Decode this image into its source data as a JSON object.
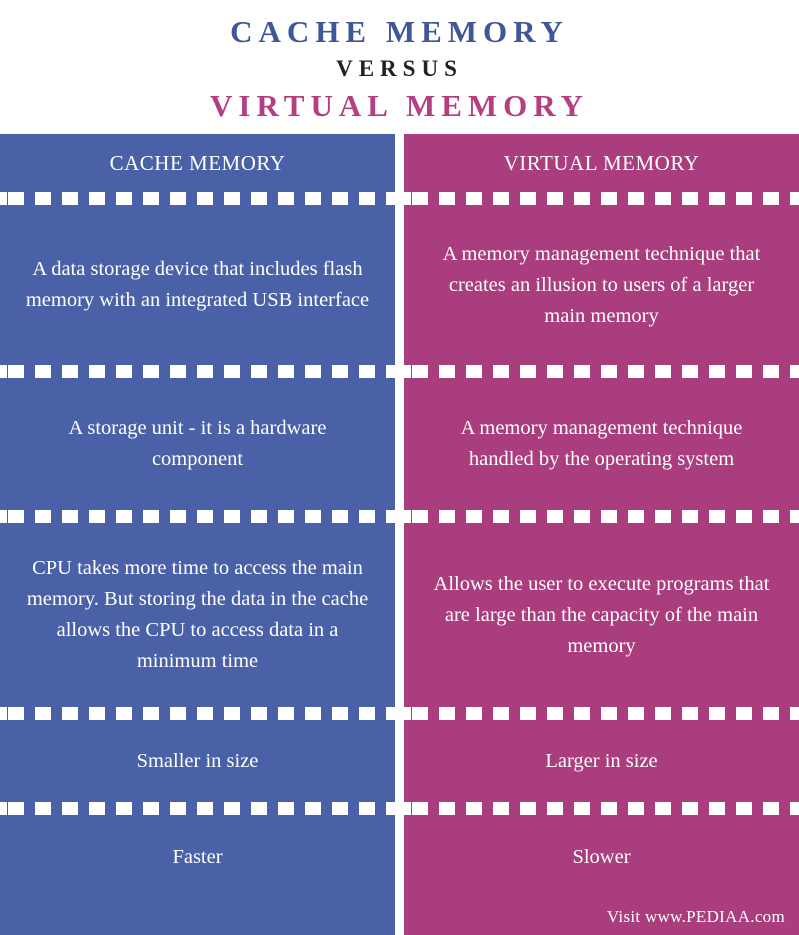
{
  "title": {
    "line1": "CACHE MEMORY",
    "line2": "VERSUS",
    "line3": "VIRTUAL MEMORY",
    "color_line1": "#3f5699",
    "color_line2": "#222222",
    "color_line3": "#b33f80"
  },
  "table": {
    "left_column": {
      "header": "CACHE MEMORY",
      "color": "#4a61a8",
      "rows": [
        "A data storage device that includes flash memory with an integrated USB interface",
        "A storage unit - it is a hardware component",
        "CPU takes more time to access the main memory. But storing the data in the cache allows the CPU to access data in a minimum time",
        "Smaller in size",
        "Faster"
      ]
    },
    "right_column": {
      "header": "VIRTUAL MEMORY",
      "color": "#a93d7d",
      "rows": [
        "A memory management technique that creates an illusion to users of a larger main memory",
        "A memory management technique handled by the operating system",
        "Allows the user to execute programs that are large than the capacity of the main memory",
        "Larger in size",
        "Slower"
      ]
    }
  },
  "footer": {
    "text": "Visit www.PEDIAA.com"
  }
}
